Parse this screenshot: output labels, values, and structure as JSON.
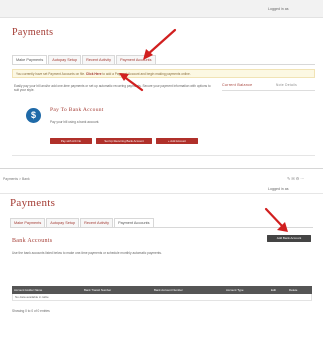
{
  "top": {
    "logged_in": "Logged in as",
    "title": "Payments",
    "tabs": [
      {
        "label": "Make Payments"
      },
      {
        "label": "Autopay Setup"
      },
      {
        "label": "Recent Activity"
      },
      {
        "label": "Payment Accounts"
      }
    ],
    "notice": {
      "prefix": "You currently have set Payment Accounts on file.",
      "link": "Click Here",
      "suffix": "to add a Payment Account and begin making payments online."
    },
    "intro_text": "Easily pay your bill and/or add one-time payments or set up automatic recurring payments. Secure your payment information with options to suit your style.",
    "pay_heading": "Pay To Bank Account",
    "pay_subtext": "Pay your bill using a bank account.",
    "buttons": {
      "b1": "Pay with A/C No",
      "b2": "Set Up Recurring Bank Account",
      "b3": "+ Add Account"
    },
    "side": {
      "heading1": "Current Balance",
      "heading2": "Note Details"
    }
  },
  "bottom": {
    "breadcrumb": "Payments > Bank",
    "logged_in": "Logged in as",
    "title": "Payments",
    "tabs": [
      {
        "label": "Make Payments"
      },
      {
        "label": "Autopay Setup"
      },
      {
        "label": "Recent Activity"
      },
      {
        "label": "Payment Accounts"
      }
    ],
    "add_button": "Add Bank Account",
    "section_title": "Bank Accounts",
    "section_text": "Use the bank accounts listed below to make one-time payments or schedule monthly automatic payments.",
    "table": {
      "columns": [
        "Account Holder Name",
        "Bank Transit Number",
        "Bank Account Number",
        "Account Type",
        "Edit",
        "Delete"
      ],
      "empty": "No data available in table",
      "footer": "Showing 0 to 0 of 0 entries"
    }
  },
  "colors": {
    "brand": "#a33a32",
    "button": "#b0302a",
    "arrow": "#d11f1f",
    "notice_bg": "#fcf8e3"
  },
  "icons": [
    "dollar-icon",
    "print-icon",
    "email-icon",
    "settings-icon"
  ]
}
